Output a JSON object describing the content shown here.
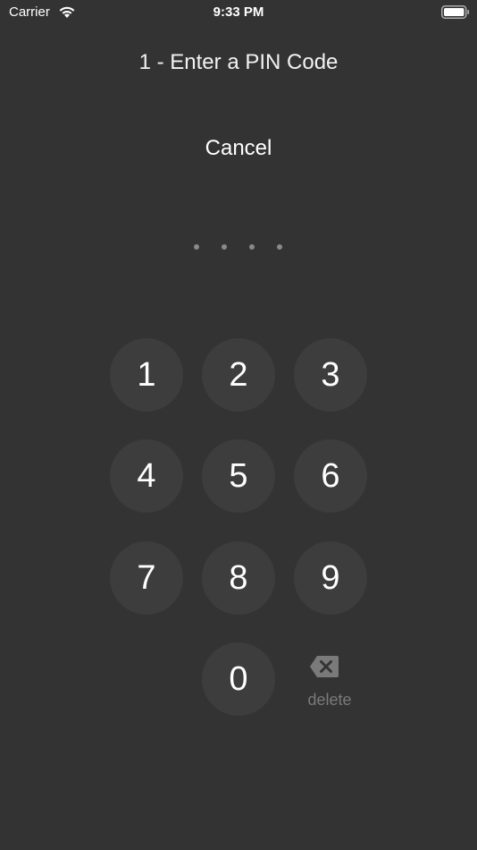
{
  "status_bar": {
    "carrier": "Carrier",
    "time": "9:33 PM",
    "wifi_icon": "wifi-icon",
    "battery_icon": "battery-icon"
  },
  "title": "1 - Enter a PIN Code",
  "cancel_label": "Cancel",
  "pin": {
    "length": 4,
    "entered": 0
  },
  "keypad": {
    "keys": [
      "1",
      "2",
      "3",
      "4",
      "5",
      "6",
      "7",
      "8",
      "9",
      "0"
    ],
    "delete_label": "delete",
    "delete_icon": "backspace-icon"
  },
  "colors": {
    "background": "#333333",
    "key_background": "#3d3d3d",
    "text": "#ffffff",
    "muted": "#7a7a7a"
  }
}
